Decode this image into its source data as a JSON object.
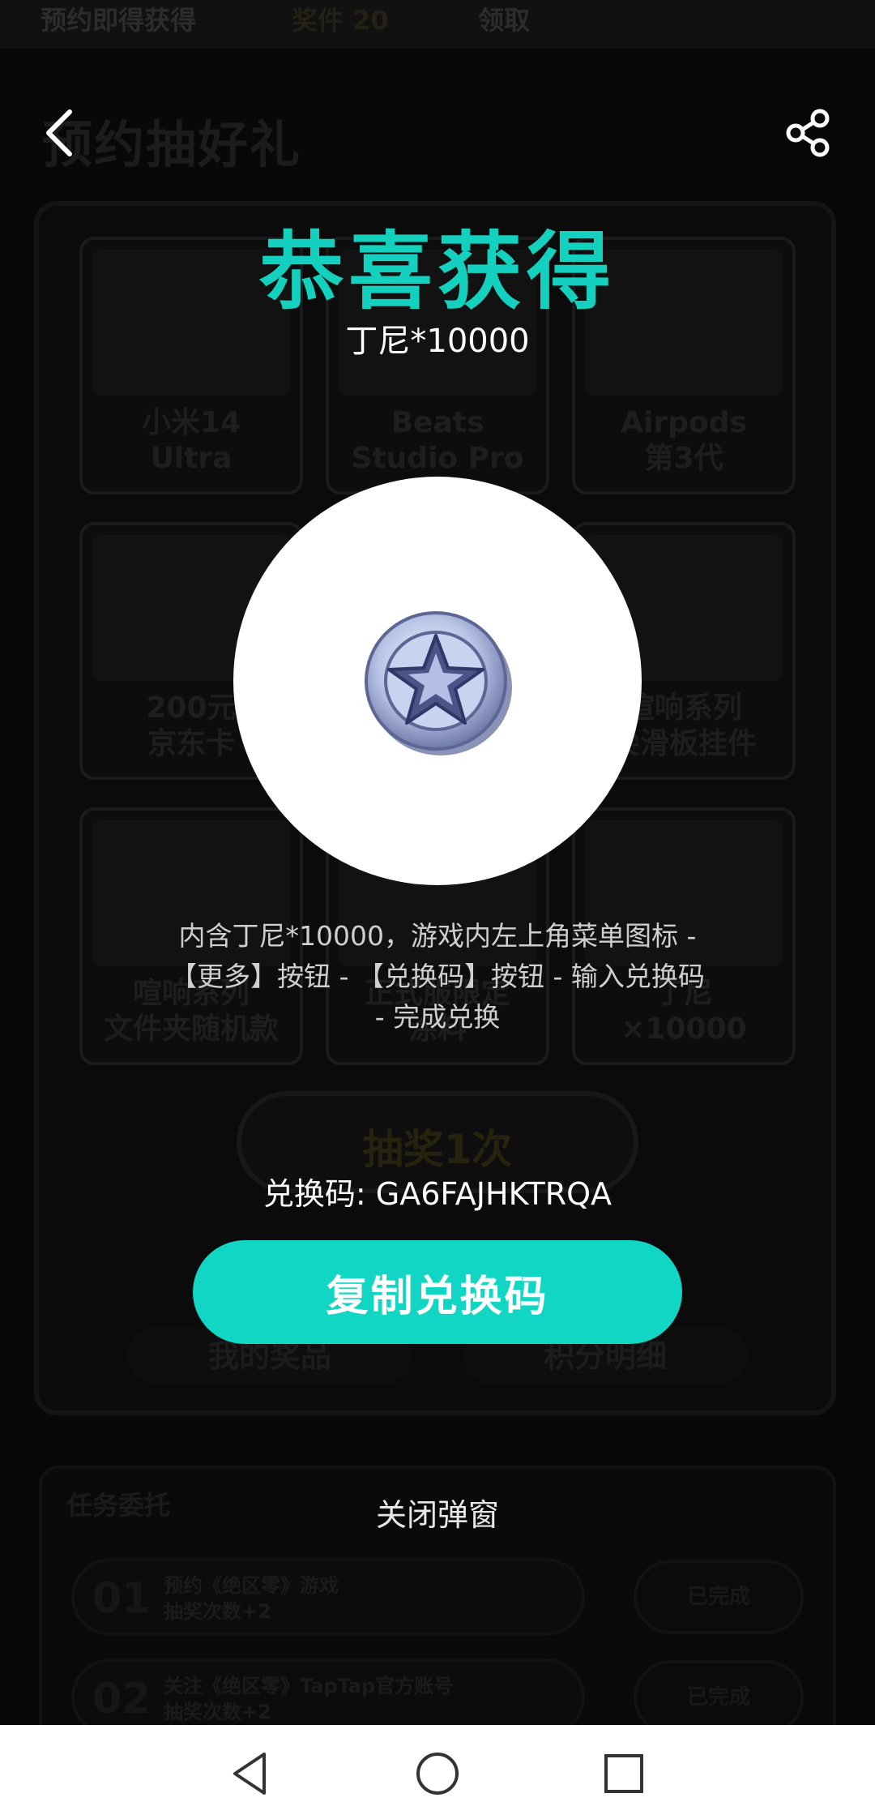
{
  "background": {
    "banner": {
      "left_text": "预约即得获得",
      "badge_text": "奖件 20",
      "right_text": "领取"
    },
    "page_title": "预约抽好礼",
    "prizes": [
      {
        "label": "小米14\nUltra"
      },
      {
        "label": "Beats\nStudio Pro"
      },
      {
        "label": "Airpods\n第3代"
      },
      {
        "label": "200元\n京东卡"
      },
      {
        "label": ""
      },
      {
        "label": "喧响系列\n尖滑板挂件"
      },
      {
        "label": "喧响系列\n文件夹随机款"
      },
      {
        "label": "正式服限定\n涂料"
      },
      {
        "label": "丁尼\n×10000"
      }
    ],
    "draw_button": "抽奖1次",
    "my_prizes": "我的奖品",
    "points_detail": "积分明细",
    "tasks_title": "任务委托",
    "tasks": [
      {
        "num": "01",
        "text": "预约《绝区零》游戏\n抽奖次数+2",
        "status": "已完成"
      },
      {
        "num": "02",
        "text": "关注《绝区零》TapTap官方账号\n抽奖次数+2",
        "status": "已完成"
      }
    ]
  },
  "popup": {
    "title": "恭喜获得",
    "prize_name": "丁尼*10000",
    "prize_icon": "denny-coin-icon",
    "description": "内含丁尼*10000，游戏内左上角菜单图标 - 【更多】按钮 - 【兑换码】按钮 - 输入兑换码 - 完成兑换",
    "code_line": "兑换码: GA6FAJHKTRQA",
    "copy_button": "复制兑换码",
    "close_label": "关闭弹窗"
  },
  "colors": {
    "accent": "#13d1be",
    "button": "#10d6c3"
  },
  "icons": {
    "back": "chevron-left-icon",
    "share": "share-icon",
    "nav_back": "triangle-back-icon",
    "nav_home": "circle-home-icon",
    "nav_recent": "square-recent-icon"
  }
}
